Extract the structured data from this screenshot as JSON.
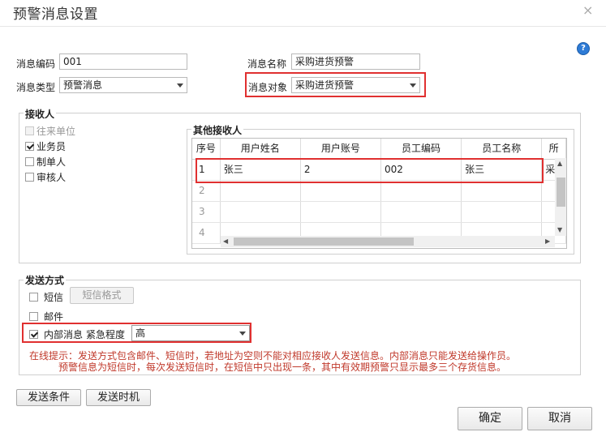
{
  "dialog": {
    "title": "预警消息设置",
    "close_glyph": "×",
    "help_glyph": "?"
  },
  "form": {
    "msg_code_label": "消息编码",
    "msg_code_value": "001",
    "msg_name_label": "消息名称",
    "msg_name_value": "采购进货预警",
    "msg_type_label": "消息类型",
    "msg_type_value": "预警消息",
    "msg_target_label": "消息对象",
    "msg_target_value": "采购进货预警"
  },
  "receivers": {
    "title": "接收人",
    "options": [
      {
        "label": "往来单位",
        "checked": false,
        "disabled": true
      },
      {
        "label": "业务员",
        "checked": true,
        "disabled": false
      },
      {
        "label": "制单人",
        "checked": false,
        "disabled": false
      },
      {
        "label": "审核人",
        "checked": false,
        "disabled": false
      }
    ],
    "others_title": "其他接收人",
    "columns": [
      "序号",
      "用户姓名",
      "用户账号",
      "员工编码",
      "员工名称",
      "所"
    ],
    "rows": [
      [
        "1",
        "张三",
        "2",
        "002",
        "张三",
        "采"
      ],
      [
        "2",
        "",
        "",
        "",
        "",
        ""
      ],
      [
        "3",
        "",
        "",
        "",
        "",
        ""
      ],
      [
        "4",
        "",
        "",
        "",
        "",
        ""
      ]
    ]
  },
  "send": {
    "title": "发送方式",
    "sms_label": "短信",
    "sms_checked": false,
    "sms_format_button": "短信格式",
    "email_label": "邮件",
    "email_checked": false,
    "internal_label": "内部消息",
    "internal_checked": true,
    "urgency_label": "紧急程度",
    "urgency_value": "高",
    "note_line1": "在线提示：发送方式包含邮件、短信时，若地址为空则不能对相应接收人发送信息。内部消息只能发送给操作员。",
    "note_line2": "预警信息为短信时，每次发送短信时，在短信中只出现一条，其中有效期预警只显示最多三个存货信息。"
  },
  "buttons": {
    "send_condition": "发送条件",
    "send_timing": "发送时机",
    "ok": "确定",
    "cancel": "取消"
  },
  "colors": {
    "highlight": "#e03030",
    "note": "#c0392b",
    "help": "#2e7bd6"
  }
}
